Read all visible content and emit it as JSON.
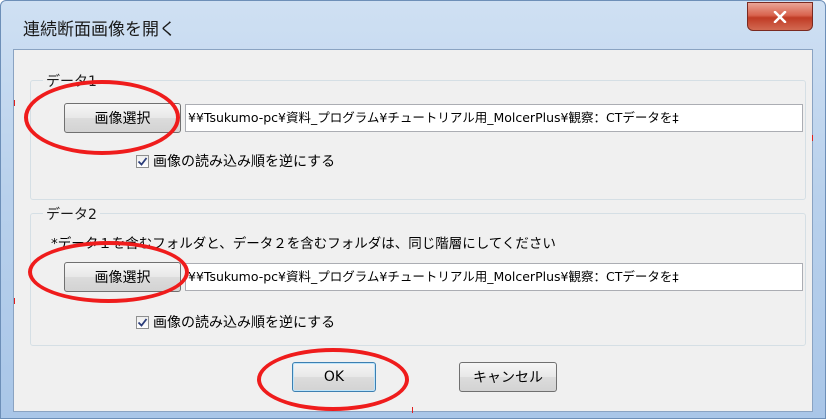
{
  "window": {
    "title": "連続断面画像を開く",
    "close_label": "x"
  },
  "data1": {
    "legend": "データ1",
    "select_button": "画像選択",
    "path": "¥¥Tsukumo-pc¥資料_プログラム¥チュートリアル用_MolcerPlus¥観察：CTデータを‡",
    "reverse_label": "画像の読み込み順を逆にする",
    "reverse_checked": true
  },
  "data2": {
    "legend": "データ2",
    "note": "*データ１を含むフォルダと、データ２を含むフォルダは、同じ階層にしてください",
    "select_button": "画像選択",
    "path": "¥¥Tsukumo-pc¥資料_プログラム¥チュートリアル用_MolcerPlus¥観察：CTデータを‡",
    "reverse_label": "画像の読み込み順を逆にする",
    "reverse_checked": true
  },
  "footer": {
    "ok_label": "OK",
    "cancel_label": "キャンセル"
  },
  "colors": {
    "annotation_ring": "#ef1c1c",
    "close_button": "#c03b25"
  },
  "icons": {
    "close": "close-icon",
    "check": "check-icon"
  }
}
